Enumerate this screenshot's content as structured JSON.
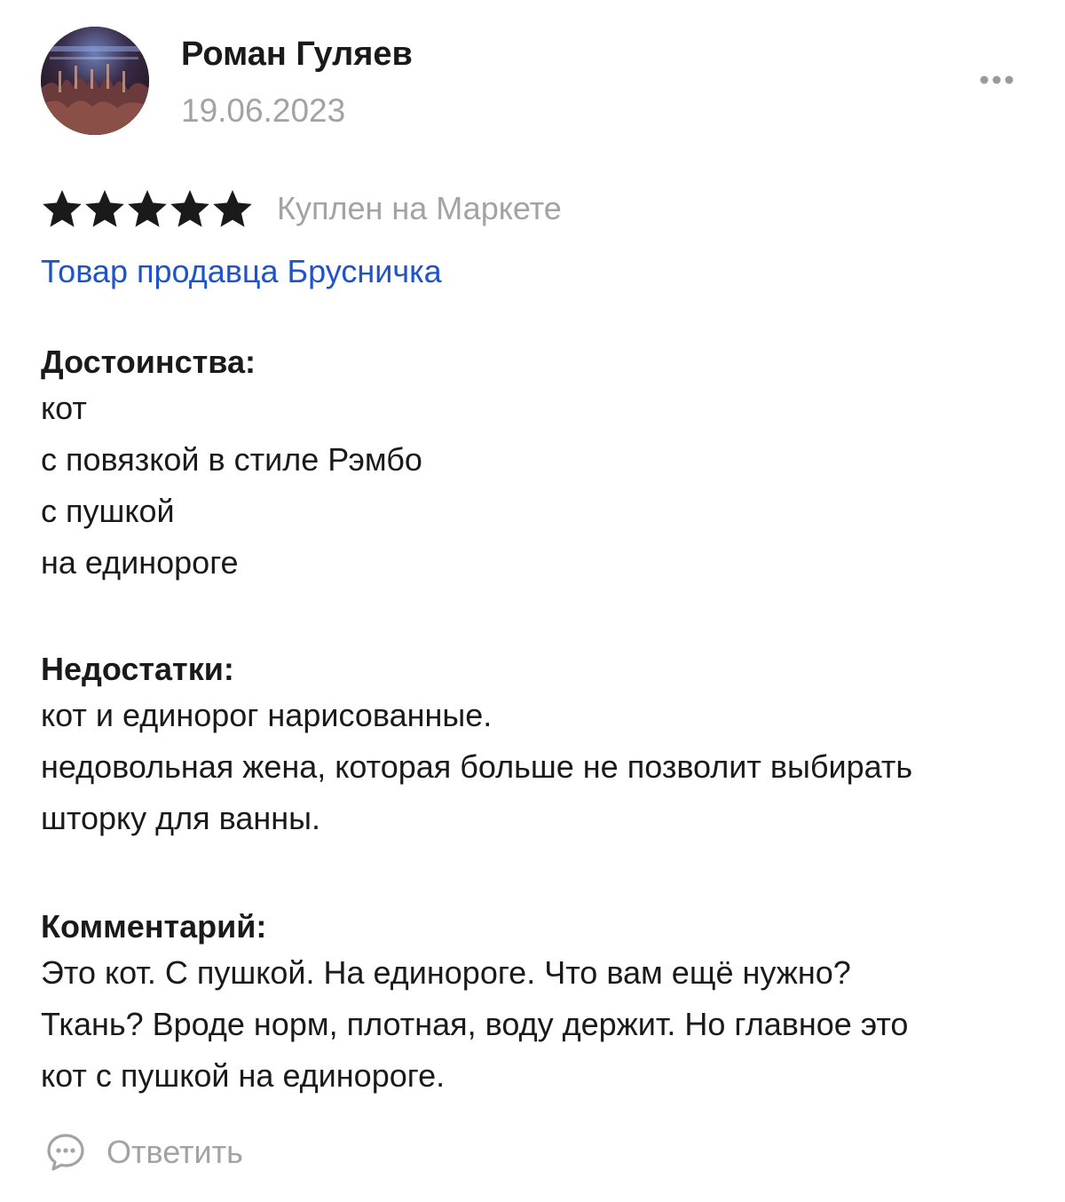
{
  "review": {
    "author": "Роман Гуляев",
    "date": "19.06.2023",
    "rating": 5,
    "rating_max": 5,
    "purchase_note": "Куплен на Маркете",
    "seller_link": "Товар продавца Брусничка",
    "pros": {
      "heading": "Достоинства:",
      "lines": [
        "кот",
        "с повязкой в стиле Рэмбо",
        "с пушкой",
        "на единороге"
      ]
    },
    "cons": {
      "heading": "Недостатки:",
      "lines": [
        "кот и единорог нарисованные.",
        "недовольная жена, которая больше не позволит выбирать",
        "шторку для ванны."
      ]
    },
    "comment": {
      "heading": "Комментарий:",
      "lines": [
        "Это кот. С пушкой. На единороге. Что вам ещё нужно?",
        "Ткань? Вроде норм, плотная, воду держит. Но главное это",
        "кот с пушкой на единороге."
      ]
    },
    "reply_label": "Ответить"
  },
  "colors": {
    "text": "#1a1a1a",
    "muted": "#a3a3a3",
    "link": "#1f53c8",
    "star": "#1a1a1a"
  },
  "icons": {
    "more": "more-dots-icon",
    "star": "star-icon",
    "reply": "speech-bubble-icon"
  }
}
